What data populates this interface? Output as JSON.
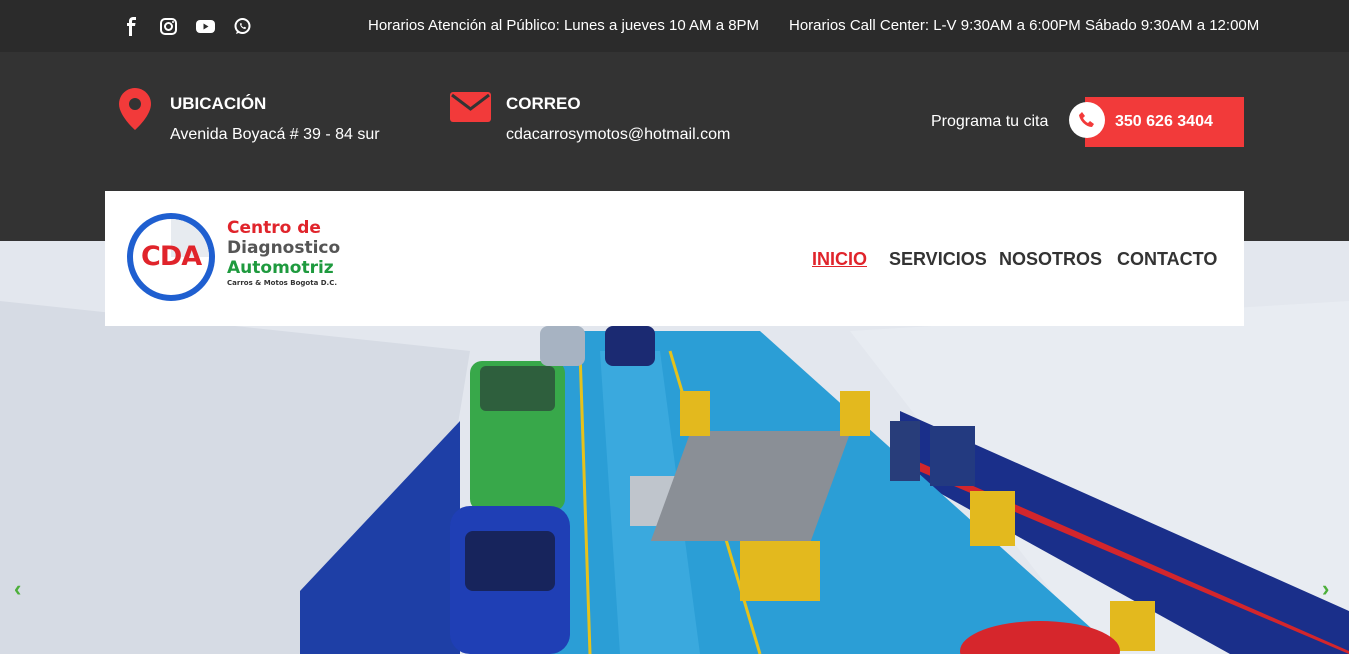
{
  "topbar": {
    "social_icons": [
      "facebook-icon",
      "instagram-icon",
      "youtube-icon",
      "whatsapp-icon"
    ],
    "hours_public": "Horarios Atención al Público: Lunes a jueves 10 AM a 8PM",
    "hours_callcenter": "Horarios Call Center: L-V 9:30AM a 6:00PM Sábado 9:30AM a 12:00M"
  },
  "info": {
    "location_title": "UBICACIÓN",
    "location_text": "Avenida Boyacá # 39 - 84 sur",
    "email_title": "CORREO",
    "email_text": "cdacarrosymotos@hotmail.com",
    "appointment_label": "Programa tu cita",
    "phone": "350 626 3404"
  },
  "logo": {
    "badge": "CDA",
    "line1": "Centro de",
    "line2": "Diagnostico",
    "line3": "Automotriz",
    "subline": "Carros & Motos Bogota D.C."
  },
  "nav": {
    "items": [
      "INICIO",
      "SERVICIOS",
      "NOSOTROS",
      "CONTACTO"
    ],
    "active": "INICIO"
  },
  "slider": {
    "prev": "‹",
    "next": "›"
  },
  "colors": {
    "accent_red": "#f23a3a",
    "dark_band": "#333333",
    "top_bar": "#2b2b2b",
    "arrow_green": "#4caf3a"
  }
}
